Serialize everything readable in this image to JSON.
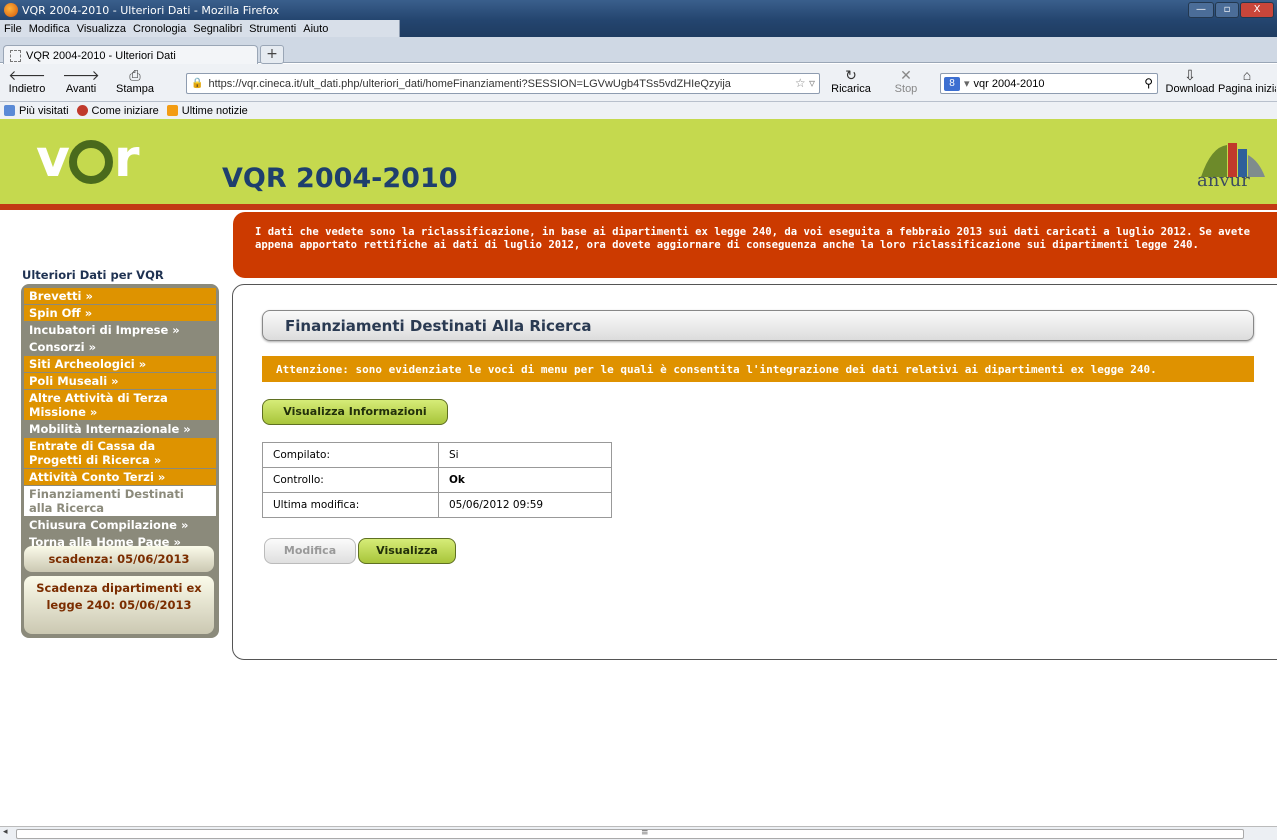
{
  "window": {
    "title": "VQR 2004-2010 - Ulteriori Dati - Mozilla Firefox",
    "min": "—",
    "max": "▫",
    "close": "X"
  },
  "menu": [
    "File",
    "Modifica",
    "Visualizza",
    "Cronologia",
    "Segnalibri",
    "Strumenti",
    "Aiuto"
  ],
  "tab": {
    "title": "VQR 2004-2010 - Ulteriori Dati",
    "new": "+"
  },
  "nav": {
    "back": "Indietro",
    "forward": "Avanti",
    "print": "Stampa",
    "reload": "Ricarica",
    "stop": "Stop",
    "download": "Download",
    "home": "Pagina iniziale"
  },
  "url": "https://vqr.cineca.it/ult_dati.php/ulteriori_dati/homeFinanziamenti?SESSION=LGVwUgb4TSs5vdZHIeQzyija",
  "search": {
    "engine": "8",
    "value": "vqr 2004-2010"
  },
  "bookmarks": [
    "Più visitati",
    "Come iniziare",
    "Ultime notizie"
  ],
  "header": {
    "logo": "vQr",
    "title": "VQR 2004-2010",
    "brand": "anvur"
  },
  "notice": "I dati che vedete sono la riclassificazione, in base ai dipartimenti ex legge 240, da voi eseguita a febbraio 2013 sui dati caricati a luglio 2012. Se avete appena apportato rettifiche ai dati di luglio 2012, ora dovete aggiornare di conseguenza anche la loro riclassificazione sui dipartimenti legge 240.",
  "sidebar": {
    "title": "Ulteriori Dati per VQR",
    "items": [
      {
        "label": "Brevetti »",
        "style": "or"
      },
      {
        "label": "Spin Off »",
        "style": "or"
      },
      {
        "label": "Incubatori di Imprese »",
        "style": "gr"
      },
      {
        "label": "Consorzi »",
        "style": "gr"
      },
      {
        "label": "Siti Archeologici »",
        "style": "or"
      },
      {
        "label": "Poli Museali »",
        "style": "or"
      },
      {
        "label": "Altre Attività di Terza Missione »",
        "style": "or"
      },
      {
        "label": "Mobilità Internazionale »",
        "style": "gr"
      },
      {
        "label": "Entrate di Cassa da Progetti di Ricerca »",
        "style": "or"
      },
      {
        "label": "Attività Conto Terzi »",
        "style": "or"
      },
      {
        "label": "Finanziamenti Destinati alla Ricerca",
        "style": "sel"
      },
      {
        "label": "Chiusura Compilazione »",
        "style": "gr"
      },
      {
        "label": "Torna alla Home Page »",
        "style": "gr"
      }
    ],
    "deadline": "scadenza: 05/06/2013",
    "deadline2": "Scadenza dipartimenti ex legge 240: 05/06/2013"
  },
  "main": {
    "heading": "Finanziamenti Destinati Alla Ricerca",
    "attention": "Attenzione: sono evidenziate le voci di menu per le quali è consentita l'integrazione dei dati relativi ai dipartimenti ex legge 240.",
    "info_button": "Visualizza Informazioni",
    "table": [
      [
        "Compilato:",
        "Si"
      ],
      [
        "Controllo:",
        "Ok"
      ],
      [
        "Ultima modifica:",
        "05/06/2012 09:59"
      ]
    ],
    "modify_button": "Modifica",
    "view_button": "Visualizza"
  },
  "colors": {
    "header": "#c5d94e",
    "notice": "#cc3a00",
    "orange": "#de9300",
    "grey": "#8b8a7b",
    "green_button": "#a8c53a"
  }
}
